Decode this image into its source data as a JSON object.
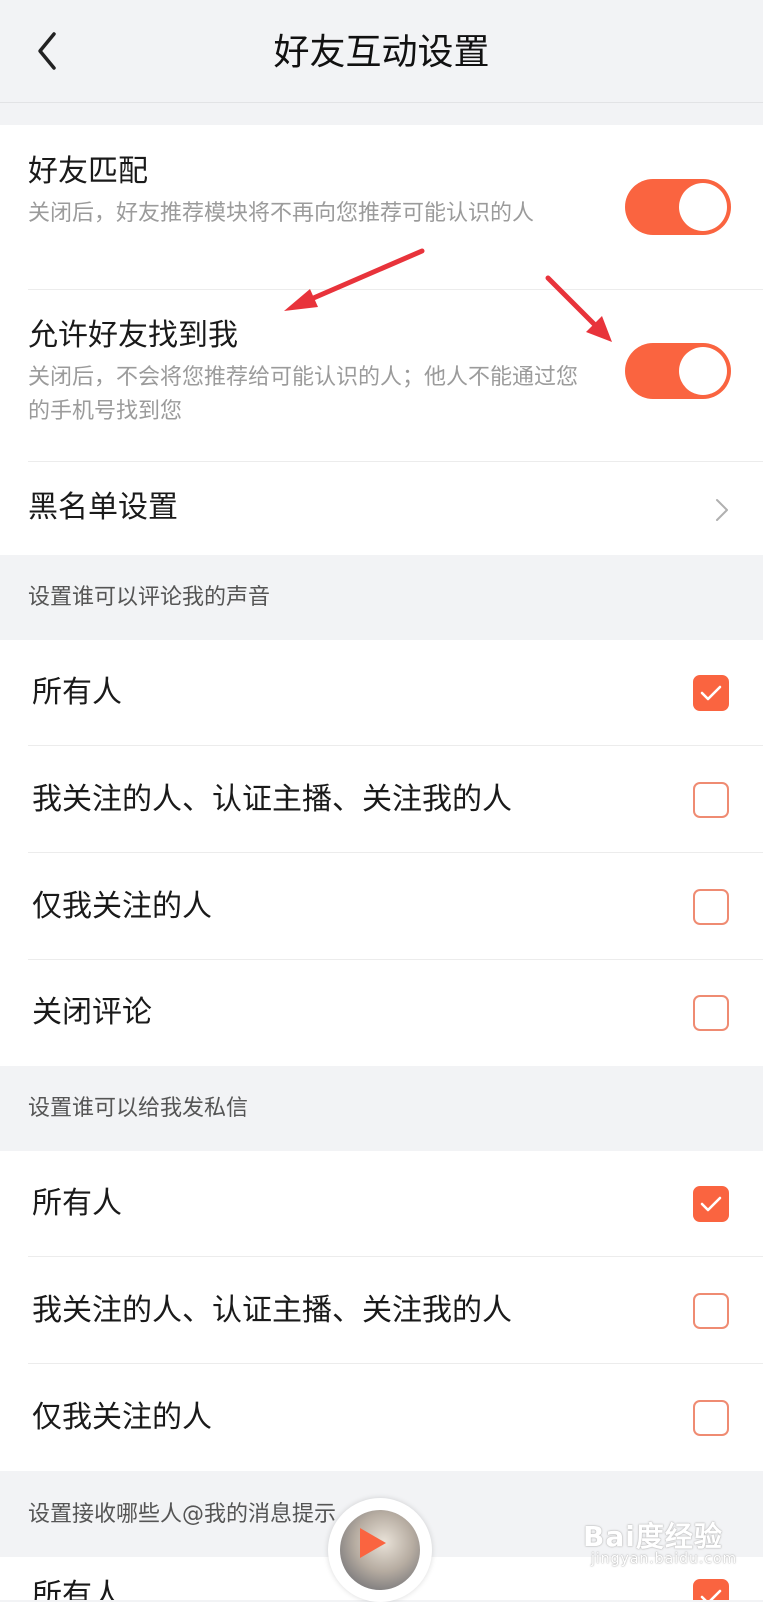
{
  "header": {
    "title": "好友互动设置",
    "back_icon": "chevron-left-icon"
  },
  "friend_settings": {
    "items": [
      {
        "title": "好友匹配",
        "description": "关闭后，好友推荐模块将不再向您推荐可能认识的人",
        "enabled": true
      },
      {
        "title": "允许好友找到我",
        "description": "关闭后，不会将您推荐给可能认识的人；他人不能通过您的手机号找到您",
        "enabled": true
      }
    ],
    "blacklist": {
      "title": "黑名单设置",
      "icon": "chevron-right-icon"
    }
  },
  "comment_section": {
    "label": "设置谁可以评论我的声音",
    "options": [
      {
        "label": "所有人",
        "checked": true
      },
      {
        "label": "我关注的人、认证主播、关注我的人",
        "checked": false
      },
      {
        "label": "仅我关注的人",
        "checked": false
      },
      {
        "label": "关闭评论",
        "checked": false
      }
    ]
  },
  "message_section": {
    "label": "设置谁可以给我发私信",
    "options": [
      {
        "label": "所有人",
        "checked": true
      },
      {
        "label": "我关注的人、认证主播、关注我的人",
        "checked": false
      },
      {
        "label": "仅我关注的人",
        "checked": false
      }
    ]
  },
  "mention_section": {
    "label": "设置接收哪些人@我的消息提示",
    "options": [
      {
        "label": "所有人",
        "checked": true
      }
    ]
  },
  "watermark": {
    "text": "Bai度经验",
    "sub": "jingyan.baidu.com"
  },
  "colors": {
    "accent": "#fa6440",
    "annotation": "#e8333b"
  }
}
